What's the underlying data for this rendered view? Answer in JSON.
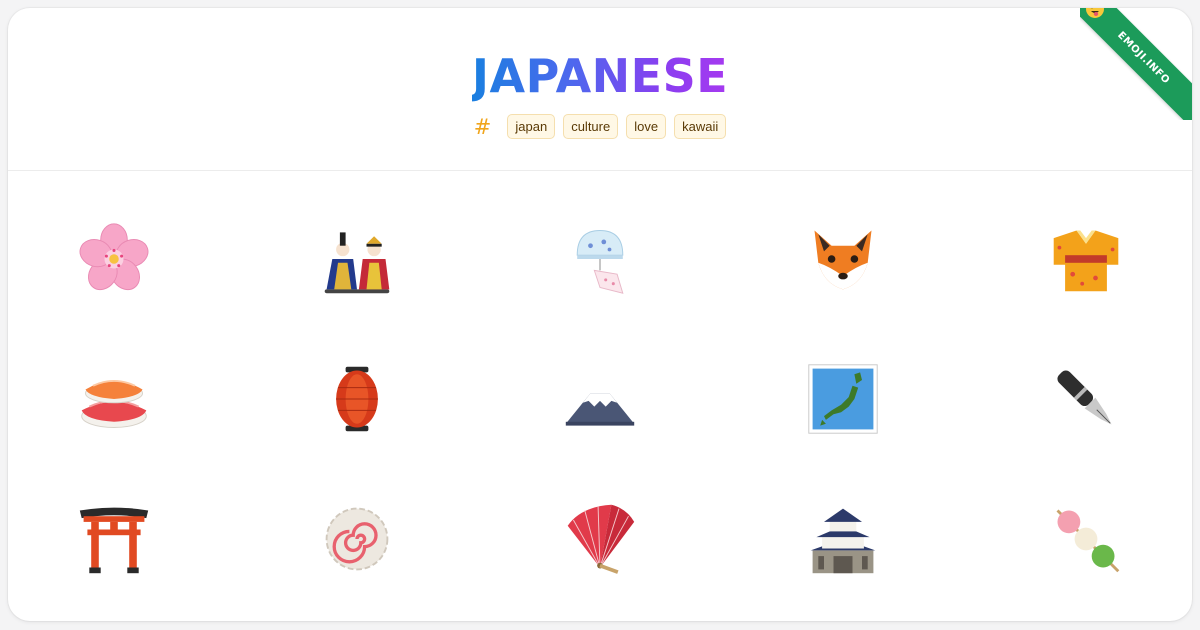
{
  "page": {
    "title": "JAPANESE",
    "title_gradient": [
      "#1a7fe0",
      "#4f67ee",
      "#8a3ef0",
      "#a63af0"
    ]
  },
  "tags": {
    "hash_symbol": "#",
    "items": [
      "japan",
      "culture",
      "love",
      "kawaii"
    ]
  },
  "ribbon": {
    "label": "EMOJI.INFO",
    "color": "#1c9b5a",
    "icon": "winking-tongue-face-icon"
  },
  "emojis": [
    {
      "name": "cherry-blossom-icon"
    },
    {
      "name": "japanese-dolls-icon"
    },
    {
      "name": "wind-chime-icon"
    },
    {
      "name": "fox-icon"
    },
    {
      "name": "kimono-icon"
    },
    {
      "name": "sushi-icon"
    },
    {
      "name": "red-paper-lantern-icon"
    },
    {
      "name": "mount-fuji-icon"
    },
    {
      "name": "map-of-japan-icon"
    },
    {
      "name": "fountain-pen-icon"
    },
    {
      "name": "shinto-shrine-icon"
    },
    {
      "name": "fish-cake-icon"
    },
    {
      "name": "folding-hand-fan-icon"
    },
    {
      "name": "japanese-castle-icon"
    },
    {
      "name": "dango-icon"
    }
  ]
}
